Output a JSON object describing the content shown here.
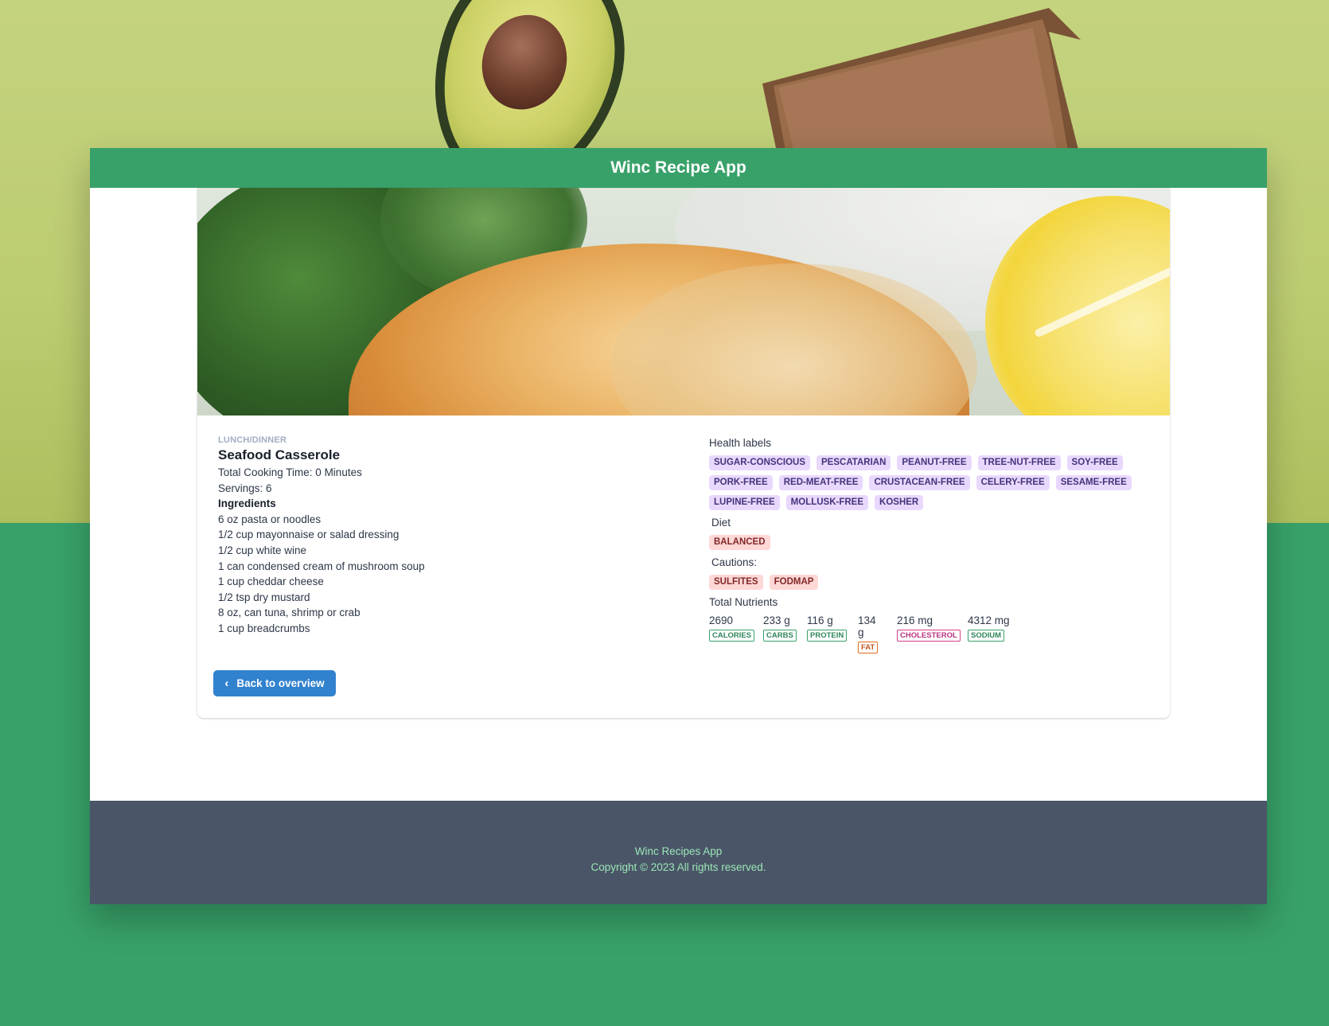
{
  "header": {
    "title": "Winc Recipe App"
  },
  "recipe": {
    "category": "LUNCH/DINNER",
    "title": "Seafood Casserole",
    "cooking_time": "Total Cooking Time: 0 Minutes",
    "servings": "Servings: 6",
    "ingredients_title": "Ingredients",
    "ingredients": [
      "6 oz pasta or noodles",
      "1/2 cup mayonnaise or salad dressing",
      "1/2 cup white wine",
      "1 can condensed cream of mushroom soup",
      "1 cup cheddar cheese",
      "1/2 tsp dry mustard",
      "8 oz, can tuna, shrimp or crab",
      "1 cup breadcrumbs"
    ]
  },
  "back_button": {
    "label": "Back to overview",
    "icon": "chevron-left-icon"
  },
  "health": {
    "label": "Health labels",
    "tags": [
      "SUGAR-CONSCIOUS",
      "PESCATARIAN",
      "PEANUT-FREE",
      "TREE-NUT-FREE",
      "SOY-FREE",
      "PORK-FREE",
      "RED-MEAT-FREE",
      "CRUSTACEAN-FREE",
      "CELERY-FREE",
      "SESAME-FREE",
      "LUPINE-FREE",
      "MOLLUSK-FREE",
      "KOSHER"
    ]
  },
  "diet": {
    "label": "Diet",
    "tags": [
      "BALANCED"
    ]
  },
  "cautions": {
    "label": "Cautions:",
    "tags": [
      "SULFITES",
      "FODMAP"
    ]
  },
  "nutrients": {
    "label": "Total Nutrients",
    "items": [
      {
        "value": "2690",
        "name": "CALORIES",
        "color": "#38a169"
      },
      {
        "value": "233 g",
        "name": "CARBS",
        "color": "#38a169"
      },
      {
        "value": "116 g",
        "name": "PROTEIN",
        "color": "#38a169"
      },
      {
        "value": "134 g",
        "name": "FAT",
        "color": "#dd6b20"
      },
      {
        "value": "216 mg",
        "name": "CHOLESTEROL",
        "color": "#d53f8c"
      },
      {
        "value": "4312 mg",
        "name": "SODIUM",
        "color": "#38a169"
      }
    ]
  },
  "footer": {
    "line1": "Winc Recipes App",
    "line2": "Copyright © 2023 All rights reserved."
  },
  "colors": {
    "brand_green": "#38a169",
    "button_blue": "#3182ce",
    "footer_bg": "#4a5568",
    "footer_text": "#9ae6b4"
  }
}
